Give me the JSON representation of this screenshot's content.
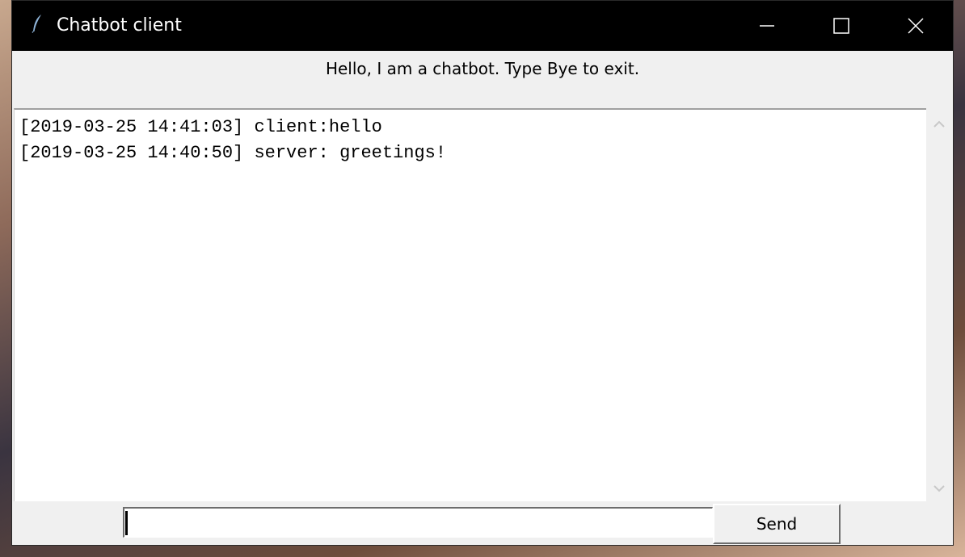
{
  "window": {
    "title": "Chatbot client",
    "app_icon": "feather-icon",
    "controls": {
      "minimize": "minimize-icon",
      "maximize": "maximize-icon",
      "close": "close-icon"
    }
  },
  "header": {
    "greeting": "Hello, I am a chatbot. Type Bye to exit."
  },
  "chat": {
    "messages": [
      "[2019-03-25 14:41:03] client:hello",
      "[2019-03-25 14:40:50] server: greetings!"
    ]
  },
  "composer": {
    "input_value": "",
    "send_label": "Send"
  },
  "colors": {
    "titlebar": "#000000",
    "window_bg": "#f0f0f0",
    "chat_bg": "#ffffff"
  }
}
